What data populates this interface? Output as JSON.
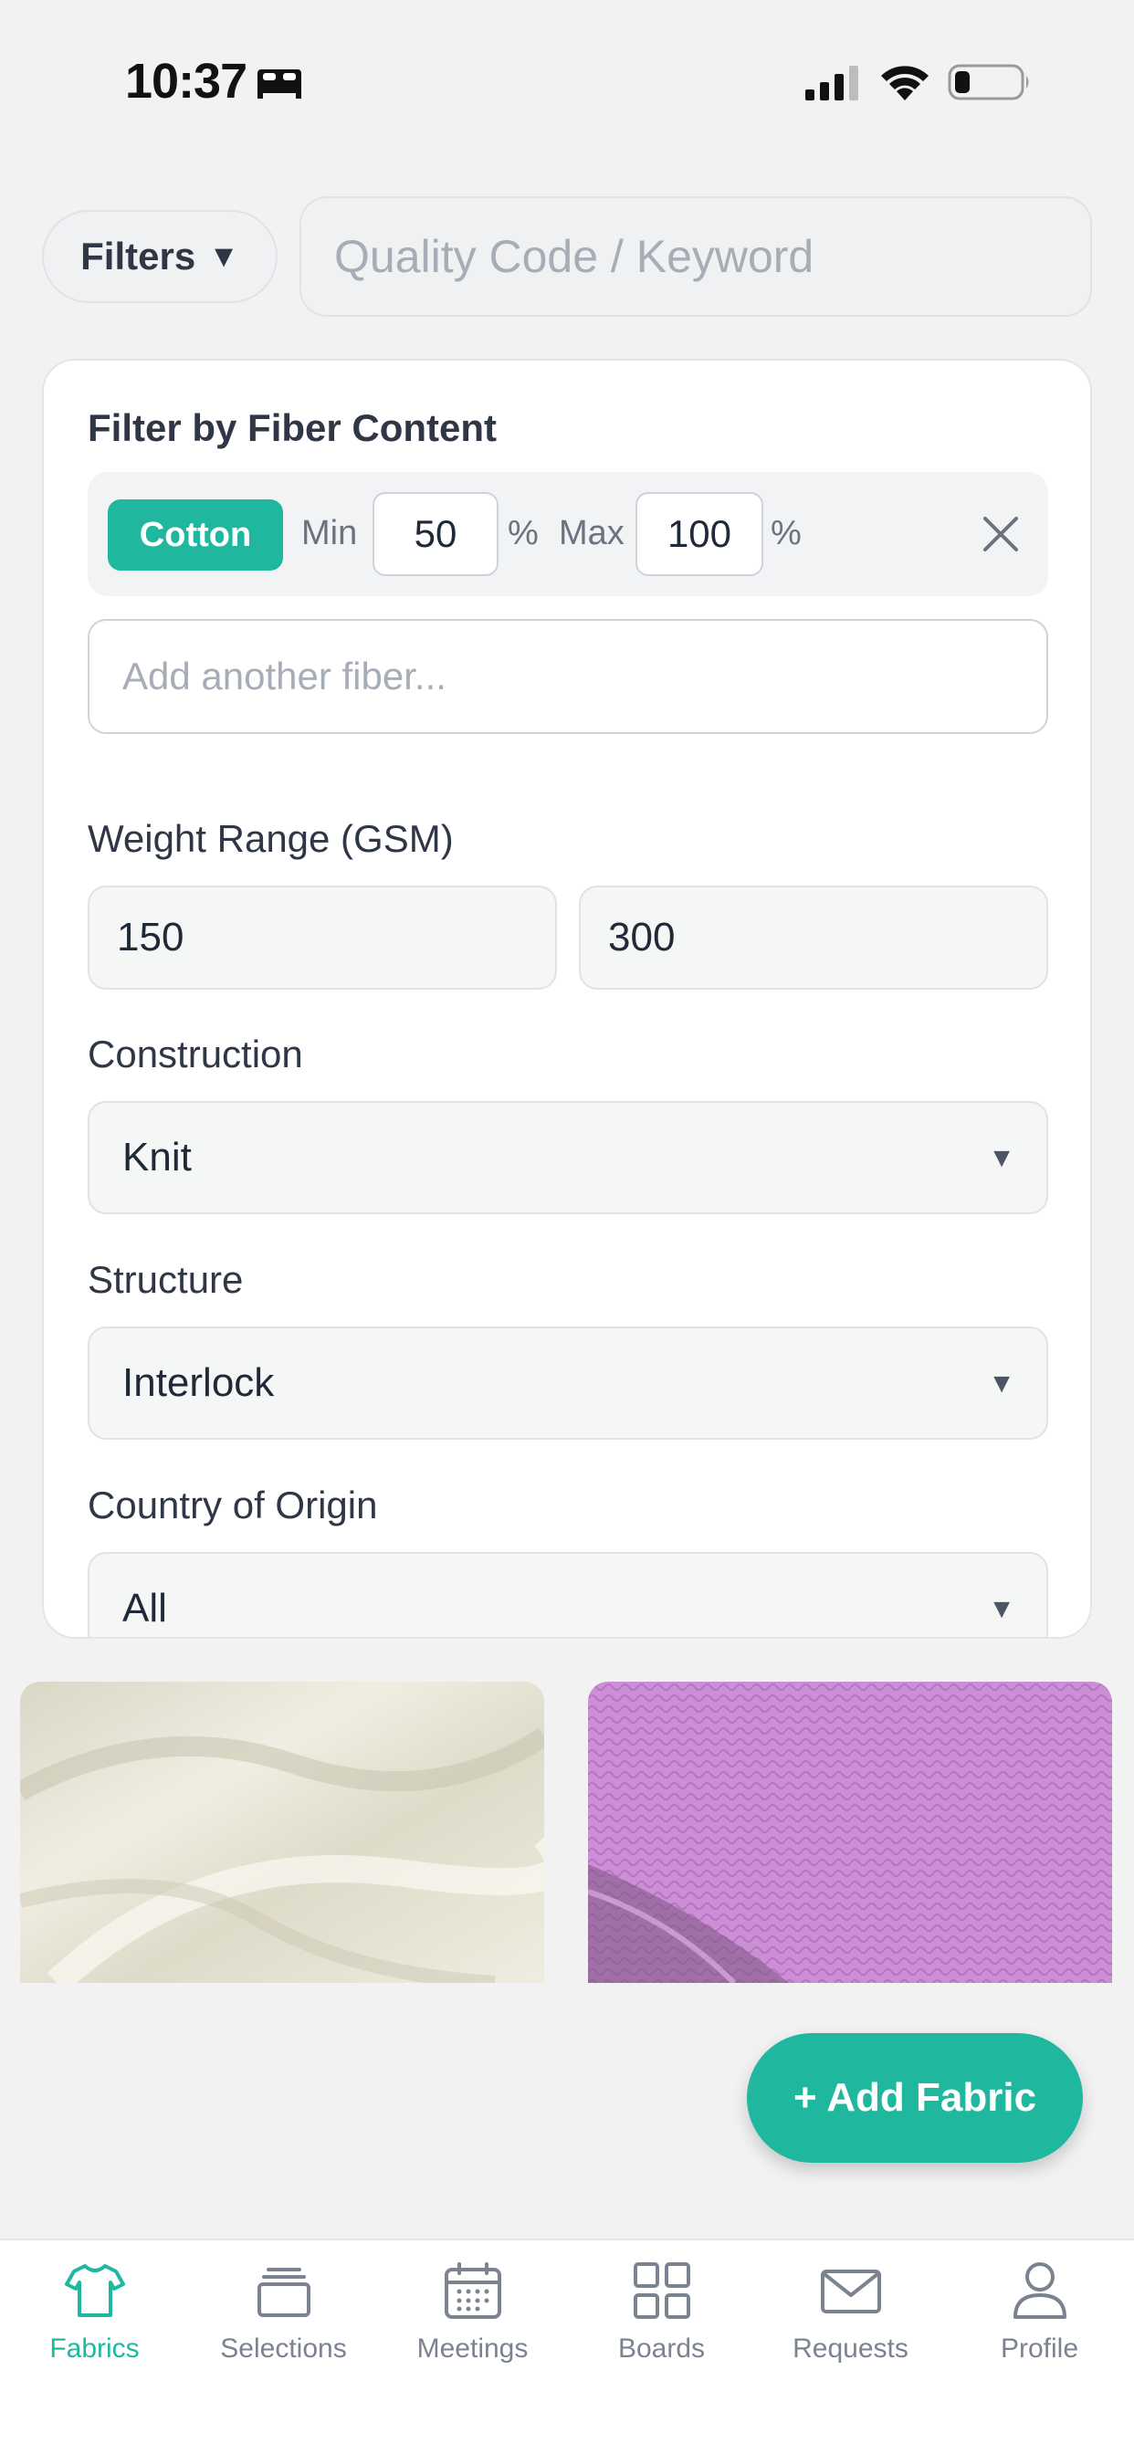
{
  "status_bar": {
    "time": "10:37",
    "icons": [
      "sleep-icon",
      "signal-icon",
      "wifi-icon",
      "battery-icon"
    ]
  },
  "search": {
    "filters_label": "Filters",
    "filters_caret": "▼",
    "placeholder": "Quality Code / Keyword"
  },
  "filter_panel": {
    "fiber_title": "Filter by Fiber Content",
    "fiber": {
      "name": "Cotton",
      "min_label": "Min",
      "min_value": "50",
      "max_label": "Max",
      "max_value": "100",
      "unit": "%"
    },
    "add_fiber_placeholder": "Add another fiber...",
    "weight_label": "Weight Range (GSM)",
    "weight_min": "150",
    "weight_max": "300",
    "construction_label": "Construction",
    "construction_value": "Knit",
    "structure_label": "Structure",
    "structure_value": "Interlock",
    "country_label": "Country of Origin",
    "country_value": "All",
    "caret": "▼"
  },
  "fabrics": [
    {
      "color": "#e9e7d9",
      "description": "cream"
    },
    {
      "color": "#c98ad4",
      "description": "purple"
    }
  ],
  "add_fabric_label": "+ Add Fabric",
  "tabs": [
    {
      "label": "Fabrics",
      "icon": "tshirt-icon",
      "active": true
    },
    {
      "label": "Selections",
      "icon": "stack-icon",
      "active": false
    },
    {
      "label": "Meetings",
      "icon": "calendar-icon",
      "active": false
    },
    {
      "label": "Boards",
      "icon": "grid-icon",
      "active": false
    },
    {
      "label": "Requests",
      "icon": "mail-icon",
      "active": false
    },
    {
      "label": "Profile",
      "icon": "user-icon",
      "active": false
    }
  ],
  "colors": {
    "accent": "#1fb89e",
    "text": "#2f3746",
    "muted": "#7b8290",
    "background": "#f2f2f3"
  }
}
